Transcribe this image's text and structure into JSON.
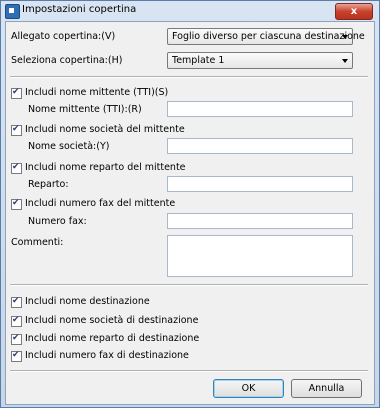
{
  "window": {
    "title": "Impostazioni copertina",
    "close_label": "x"
  },
  "attachment": {
    "label": "Allegato copertina:(V)",
    "value": "Foglio diverso per ciascuna destinazione"
  },
  "template": {
    "label": "Seleziona copertina:(H)",
    "value": "Template 1"
  },
  "sender_name": {
    "checkbox_label": "Includi nome mittente (TTI)(S)",
    "field_label": "Nome mittente (TTI):(R)",
    "checked": true,
    "value": ""
  },
  "sender_company": {
    "checkbox_label": "Includi nome società del mittente",
    "field_label": "Nome società:(Y)",
    "checked": true,
    "value": ""
  },
  "sender_department": {
    "checkbox_label": "Includi nome reparto del mittente",
    "field_label": "Reparto:",
    "checked": true,
    "value": ""
  },
  "sender_fax": {
    "checkbox_label": "Includi numero fax del mittente",
    "field_label": "Numero fax:",
    "checked": true,
    "value": ""
  },
  "comments": {
    "label": "Commenti:",
    "value": ""
  },
  "destination": {
    "items": [
      {
        "label": "Includi nome destinazione",
        "checked": true
      },
      {
        "label": "Includi nome società di destinazione",
        "checked": true
      },
      {
        "label": "Includi nome reparto di destinazione",
        "checked": true
      },
      {
        "label": "Includi numero fax di destinazione",
        "checked": true
      }
    ]
  },
  "buttons": {
    "ok": "OK",
    "cancel": "Annulla"
  }
}
